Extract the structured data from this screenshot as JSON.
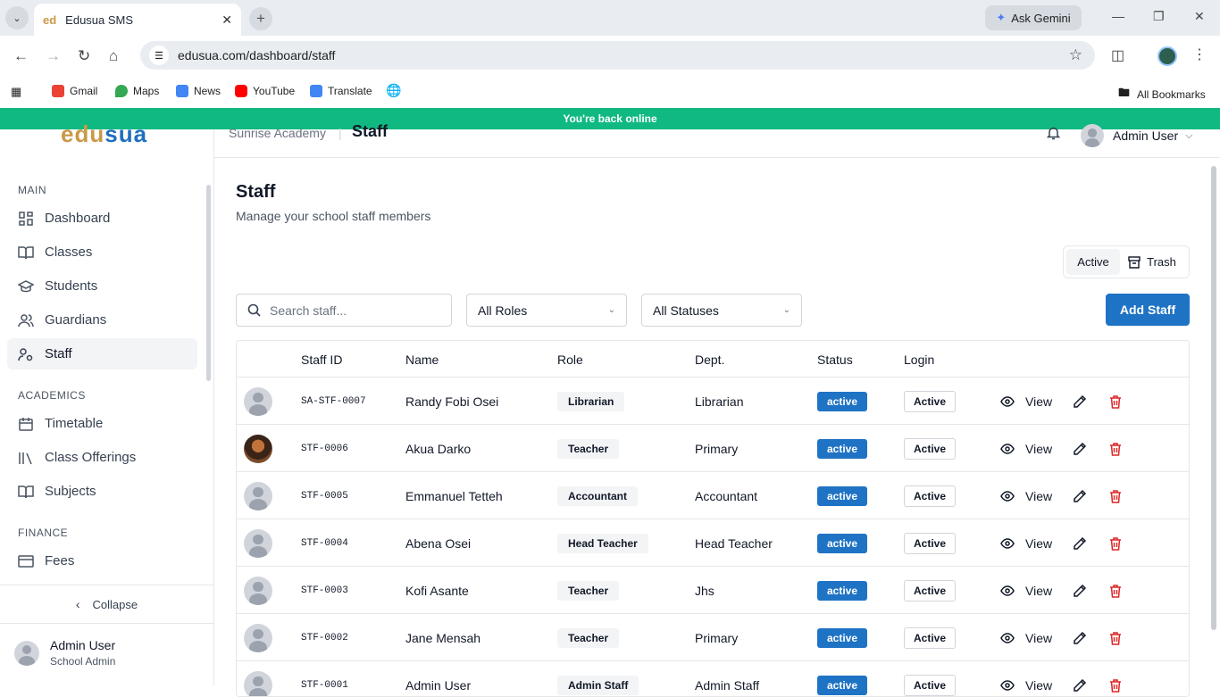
{
  "browser": {
    "tab_title": "Edusua SMS",
    "tab_favicon": "ed",
    "ask_gemini": "Ask Gemini",
    "url": "edusua.com/dashboard/staff",
    "bookmarks": [
      "Gmail",
      "Maps",
      "News",
      "YouTube",
      "Translate"
    ],
    "all_bookmarks": "All Bookmarks"
  },
  "banner": {
    "text": "You're back online"
  },
  "app": {
    "logo_part1": "edu",
    "logo_part2": "sua",
    "school": "Sunrise Academy",
    "crumb_sep": "|",
    "current_page": "Staff",
    "user_name": "Admin User",
    "user_role": "School Admin"
  },
  "sidebar": {
    "sections": {
      "main": "MAIN",
      "academics": "ACADEMICS",
      "finance": "FINANCE"
    },
    "items": {
      "dashboard": "Dashboard",
      "classes": "Classes",
      "students": "Students",
      "guardians": "Guardians",
      "staff": "Staff",
      "timetable": "Timetable",
      "class_offerings": "Class Offerings",
      "subjects": "Subjects",
      "fees": "Fees"
    },
    "collapse": "Collapse"
  },
  "page": {
    "title": "Staff",
    "subtitle": "Manage your school staff members",
    "toggle_active": "Active",
    "toggle_trash": "Trash",
    "search_placeholder": "Search staff...",
    "role_filter": "All Roles",
    "status_filter": "All Statuses",
    "add_button": "Add Staff"
  },
  "table": {
    "headers": {
      "id": "Staff ID",
      "name": "Name",
      "role": "Role",
      "dept": "Dept.",
      "status": "Status",
      "login": "Login"
    },
    "view_label": "View",
    "rows": [
      {
        "id": "SA-STF-0007",
        "name": "Randy Fobi Osei",
        "role": "Librarian",
        "dept": "Librarian",
        "status": "active",
        "login": "Active",
        "photo": false
      },
      {
        "id": "STF-0006",
        "name": "Akua Darko",
        "role": "Teacher",
        "dept": "Primary",
        "status": "active",
        "login": "Active",
        "photo": true
      },
      {
        "id": "STF-0005",
        "name": "Emmanuel Tetteh",
        "role": "Accountant",
        "dept": "Accountant",
        "status": "active",
        "login": "Active",
        "photo": false
      },
      {
        "id": "STF-0004",
        "name": "Abena Osei",
        "role": "Head Teacher",
        "dept": "Head Teacher",
        "status": "active",
        "login": "Active",
        "photo": false
      },
      {
        "id": "STF-0003",
        "name": "Kofi Asante",
        "role": "Teacher",
        "dept": "Jhs",
        "status": "active",
        "login": "Active",
        "photo": false
      },
      {
        "id": "STF-0002",
        "name": "Jane Mensah",
        "role": "Teacher",
        "dept": "Primary",
        "status": "active",
        "login": "Active",
        "photo": false
      },
      {
        "id": "STF-0001",
        "name": "Admin User",
        "role": "Admin Staff",
        "dept": "Admin Staff",
        "status": "active",
        "login": "Active",
        "photo": false
      }
    ]
  },
  "colors": {
    "accent": "#1f73c4",
    "banner": "#10b981",
    "delete": "#dc2626",
    "logo_gold": "#c99a46",
    "logo_blue": "#1f6fbf"
  }
}
